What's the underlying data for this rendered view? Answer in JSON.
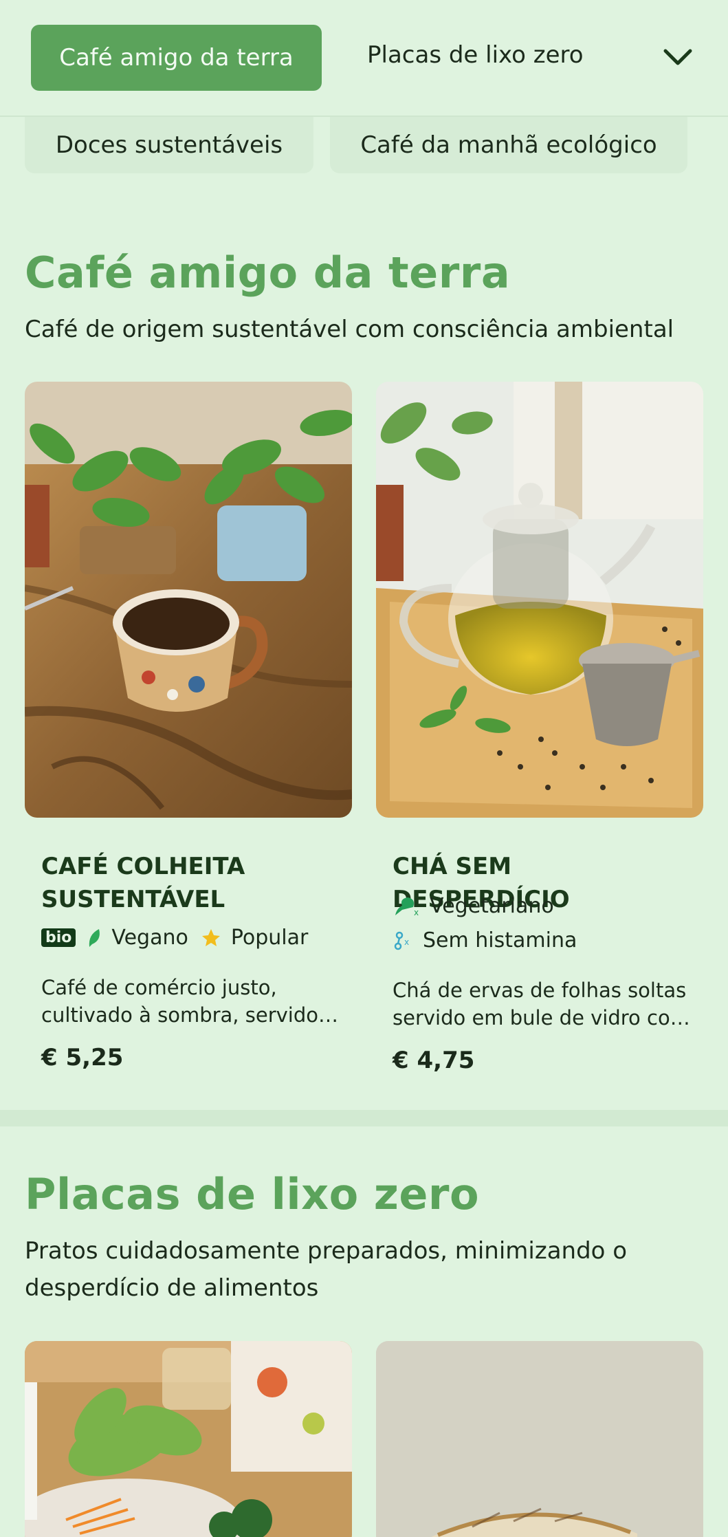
{
  "categories": {
    "active": "Café amigo da terra",
    "next": "Placas de lixo zero",
    "chip1": "Doces sustentáveis",
    "chip2": "Café da manhã ecológico"
  },
  "section1": {
    "title": "Café amigo da terra",
    "subtitle": "Café de origem sustentável com consciência ambiental",
    "items": [
      {
        "name": "CAFÉ COLHEITA SUSTENTÁVEL",
        "bio": "bio",
        "tag1": "Vegano",
        "tag2": "Popular",
        "description": "Café de comércio justo, cultivado à sombra, servido…",
        "price": "€ 5,25"
      },
      {
        "name": "CHÁ SEM DESPERDÍCIO",
        "tag1": "Vegetariano",
        "tag2": "Sem histamina",
        "description": "Chá de ervas de folhas soltas servido em bule de vidro co…",
        "price": "€ 4,75"
      }
    ]
  },
  "section2": {
    "title": "Placas de lixo zero",
    "subtitle": "Pratos cuidadosamente preparados, minimizando o desperdício de alimentos"
  },
  "colors": {
    "accent": "#5ba35b",
    "background": "#dff3df"
  }
}
